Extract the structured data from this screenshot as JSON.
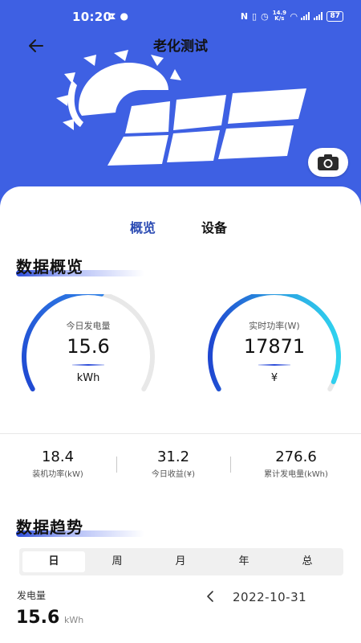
{
  "status_bar": {
    "time": "10:20",
    "net_speed_top": "14.9",
    "net_speed_bottom": "K/s",
    "battery": "87"
  },
  "header": {
    "title": "老化测试"
  },
  "tabs": [
    {
      "label": "概览",
      "active": true
    },
    {
      "label": "设备",
      "active": false
    }
  ],
  "overview": {
    "section_title": "数据概览",
    "gauges": [
      {
        "label": "今日发电量",
        "value": "15.6",
        "unit": "kWh",
        "fraction": 0.55
      },
      {
        "label": "实时功率(W)",
        "value": "17871",
        "unit": "¥",
        "fraction": 0.97
      }
    ],
    "stats": [
      {
        "value": "18.4",
        "label": "装机功率(kW)"
      },
      {
        "value": "31.2",
        "label": "今日收益(¥)"
      },
      {
        "value": "276.6",
        "label": "累计发电量(kWh)"
      }
    ]
  },
  "trend": {
    "section_title": "数据趋势",
    "periods": [
      "日",
      "周",
      "月",
      "年",
      "总"
    ],
    "active_period": "日",
    "metric_label": "发电量",
    "date": "2022-10-31",
    "value": "15.6",
    "unit": "kWh"
  },
  "colors": {
    "header_bg": "#3e60e3",
    "accent": "#2b4bb3",
    "gauge_track": "#e8e8e8",
    "gauge_blue": "#1f47d1",
    "gauge_cyan": "#2fd3ef"
  },
  "icons": [
    "back-arrow-icon",
    "solar-panel-icon",
    "camera-icon",
    "chevron-left-icon"
  ]
}
